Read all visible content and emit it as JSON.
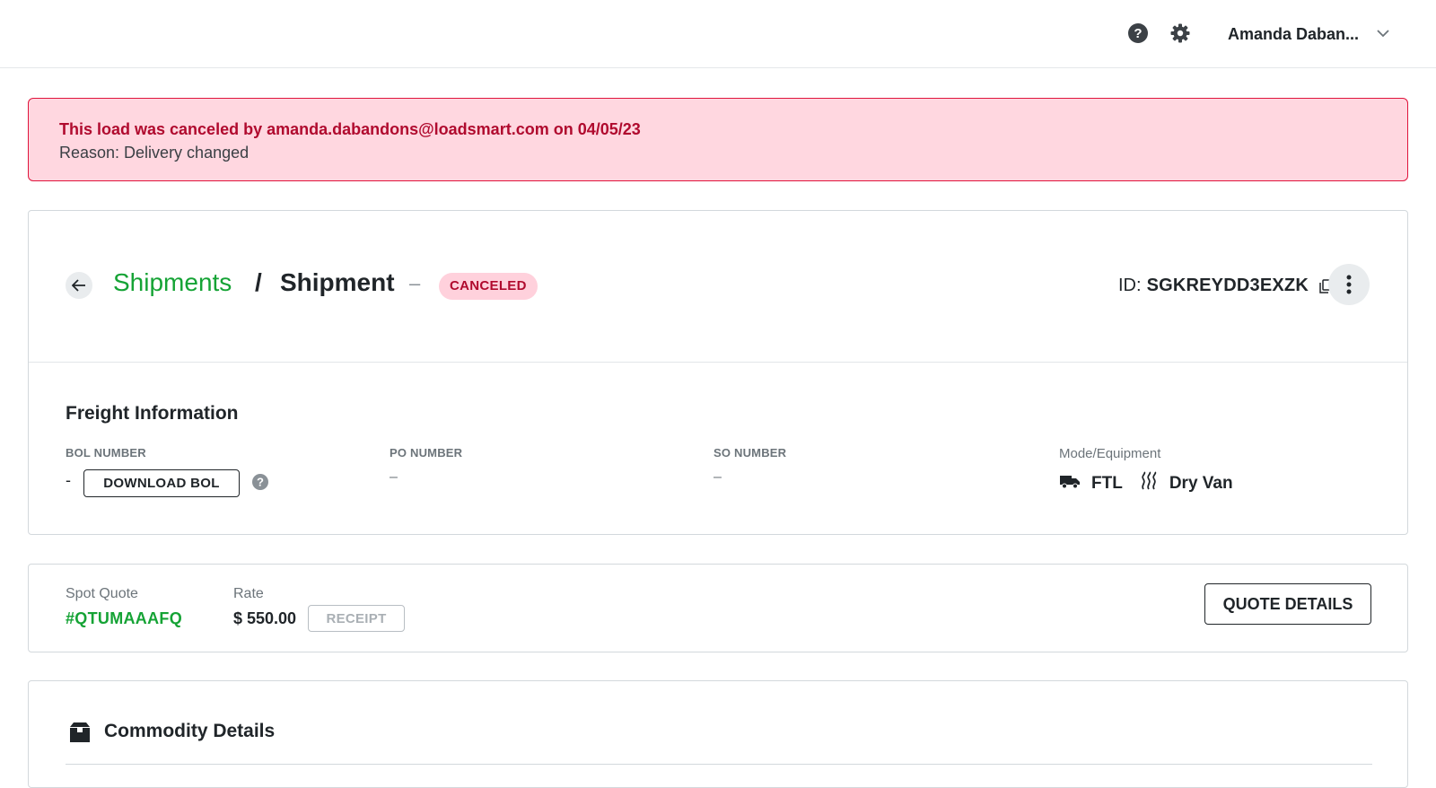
{
  "topbar": {
    "user_name": "Amanda Daban...",
    "icons": [
      "help-circle-icon",
      "gear-icon",
      "chevron-down-icon"
    ]
  },
  "alert": {
    "title": "This load was canceled by amanda.dabandons@loadsmart.com on 04/05/23",
    "reason": "Reason: Delivery changed",
    "colors": {
      "background": "#ffd7e0",
      "border": "#e0143c",
      "title": "#b00a2e"
    }
  },
  "header": {
    "breadcrumb_link": "Shipments",
    "breadcrumb_sep": "/",
    "breadcrumb_current": "Shipment",
    "dash": "–",
    "status": "CANCELED",
    "id_label": "ID:",
    "id_value": "SGKREYDD3EXZK",
    "accent_color": "#15a335"
  },
  "freight": {
    "title": "Freight Information",
    "bol_label": "BOL NUMBER",
    "bol_value": "-",
    "download_bol": "DOWNLOAD BOL",
    "po_label": "PO NUMBER",
    "po_value": "–",
    "so_label": "SO NUMBER",
    "so_value": "–",
    "mode_label": "Mode/Equipment",
    "mode": "FTL",
    "equipment": "Dry Van"
  },
  "quote": {
    "spot_label": "Spot Quote",
    "spot_value": "#QTUMAAAFQ",
    "rate_label": "Rate",
    "rate_value": "$ 550.00",
    "receipt": "RECEIPT",
    "details_button": "QUOTE DETAILS"
  },
  "commodity": {
    "title": "Commodity Details"
  }
}
